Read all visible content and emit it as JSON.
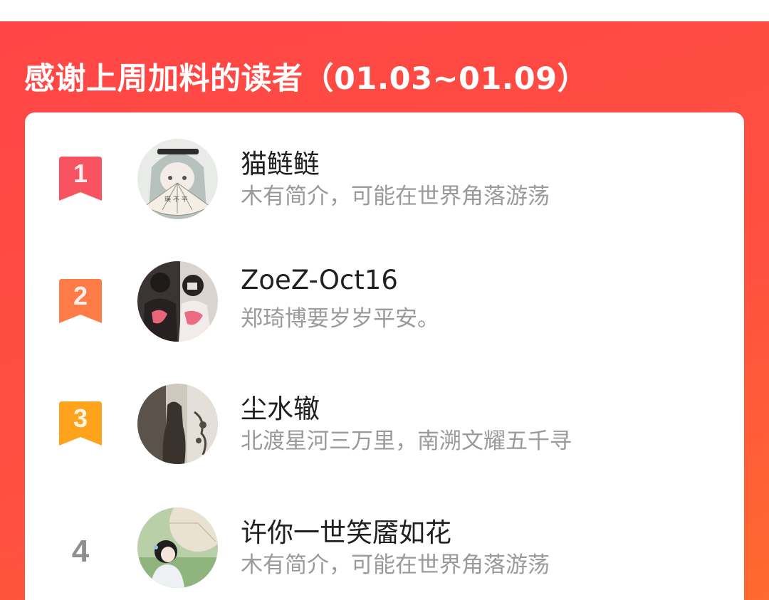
{
  "header": {
    "title": "感谢上周加料的读者（01.03~01.09）"
  },
  "colors": {
    "banner": "#ff4646",
    "rank1": "#f85360",
    "rank2": "#ff7b47",
    "rank3": "#ffa21c",
    "rank_plain": "#8e8e8e"
  },
  "readers": [
    {
      "rank": "1",
      "name": "猫鲢鲢",
      "bio": "木有简介，可能在世界角落游荡",
      "avatar_icon": "anime-girl-fan-avatar"
    },
    {
      "rank": "2",
      "name": "ZoeZ-Oct16",
      "bio": "郑琦博要岁岁平安。",
      "avatar_icon": "couple-photo-avatar"
    },
    {
      "rank": "3",
      "name": "尘水辙",
      "bio": "北渡星河三万里，南溯文耀五千寻",
      "avatar_icon": "silhouette-window-avatar"
    },
    {
      "rank": "4",
      "name": "许你一世笑靥如花",
      "bio": "木有简介，可能在世界角落游荡",
      "avatar_icon": "girl-parasol-avatar"
    }
  ]
}
